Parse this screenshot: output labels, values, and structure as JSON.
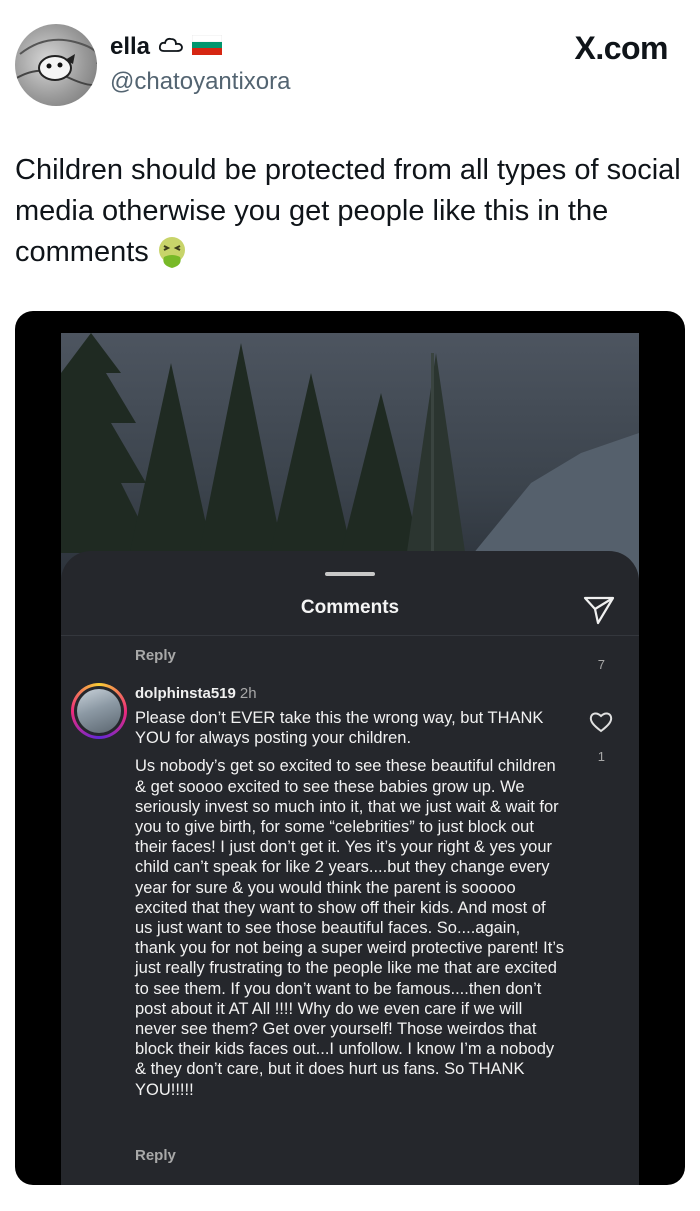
{
  "tweet": {
    "display_name": "ella",
    "name_icons": [
      "cloud-icon",
      "bulgaria-flag-icon"
    ],
    "handle": "@chatoyantixora",
    "site": "X.com",
    "text": "Children should be protected from all types of social media otherwise you get people like this in the comments",
    "emoji": "nauseated-face-icon"
  },
  "comments_screen": {
    "title": "Comments",
    "prev_reply_label": "Reply",
    "prev_reply_count": "7",
    "comment": {
      "username": "dolphinsta519",
      "time": "2h",
      "paragraph_1": "Please don’t EVER take this the wrong way, but THANK YOU for always posting your children.",
      "paragraph_2": "Us nobody’s get so excited to see these beautiful children & get soooo excited to see these babies grow up. We seriously invest so much into it, that we just wait & wait for you to give birth, for some “celebrities” to just block out their faces! I just don’t get it. Yes it’s your right & yes your child can’t speak for like 2 years....but they change every year for sure & you would think the parent is sooooo excited that they want to show off their kids. And most of us just want to see those beautiful faces. So....again, thank you for not being a super weird protective parent! It’s just really frustrating to the people like me that are excited to see them. If you don’t want to be famous....then don’t post about it AT All !!!! Why do we even care if we will never see them? Get over yourself! Those weirdos that block their kids faces out...I unfollow. I know I’m a nobody & they don’t care, but it does hurt us fans. So THANK YOU!!!!!",
      "like_count": "1",
      "reply_label": "Reply"
    }
  },
  "colors": {
    "sheet_bg": "#25272c",
    "handle_gray": "#536471",
    "text_dark": "#0f1419"
  }
}
